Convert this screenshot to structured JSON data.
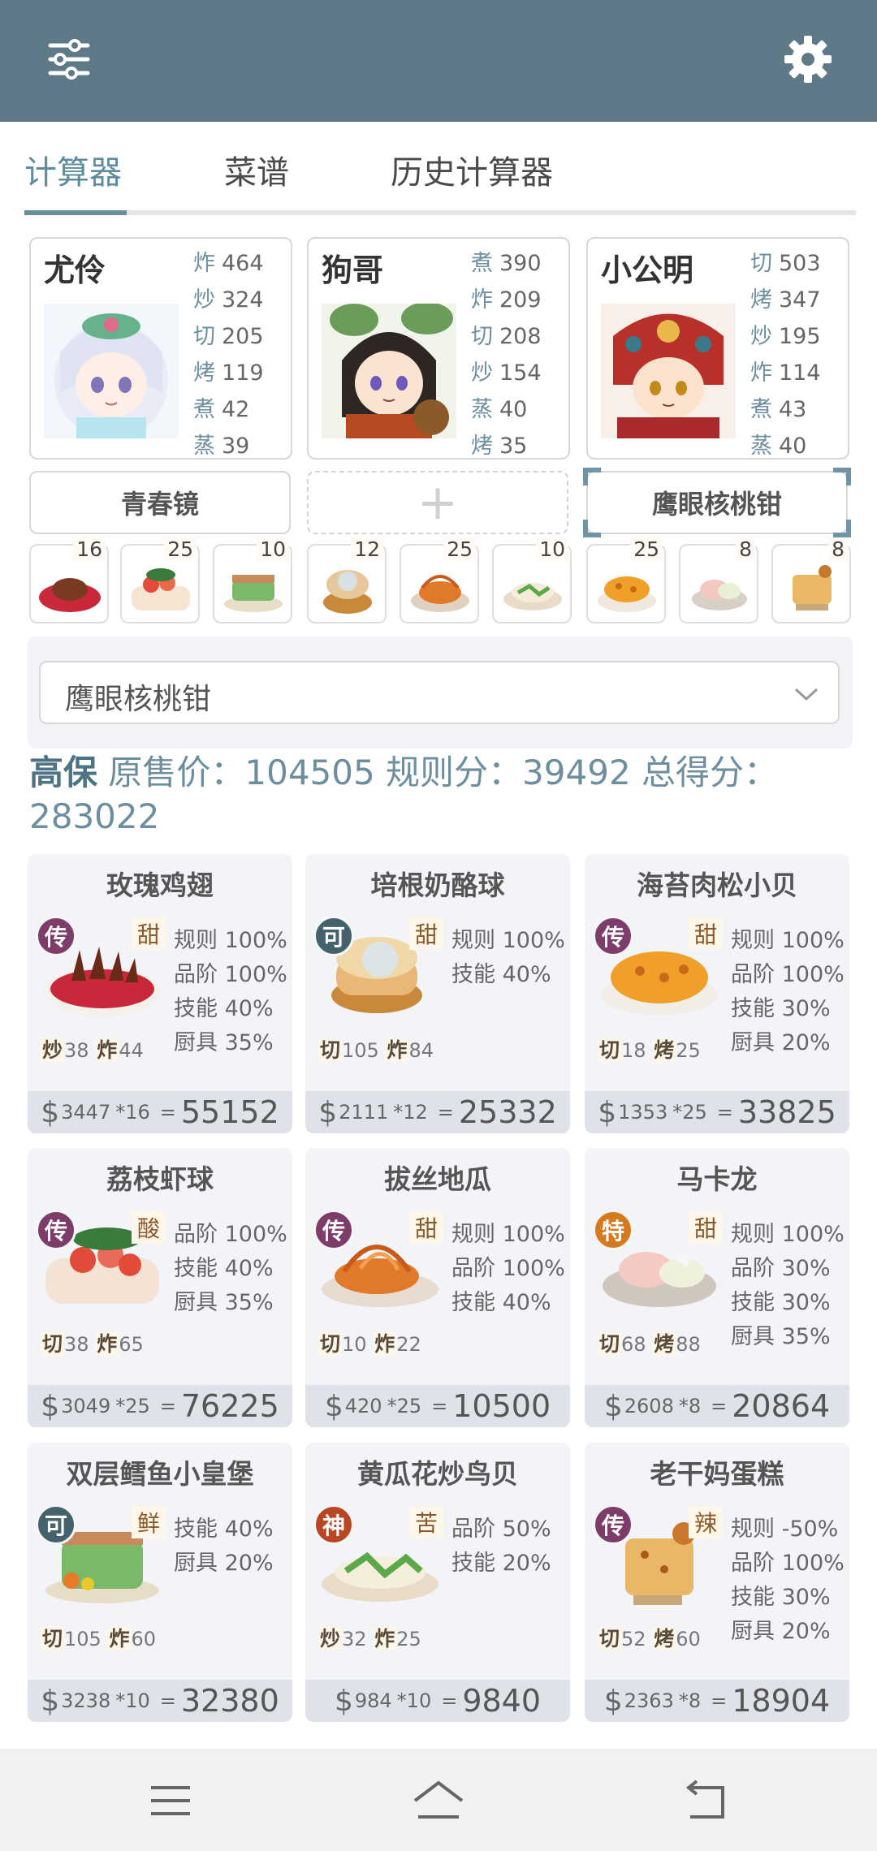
{
  "tabs": [
    {
      "label": "计算器",
      "active": true
    },
    {
      "label": "菜谱",
      "active": false
    },
    {
      "label": "历史计算器",
      "active": false
    }
  ],
  "chefs": [
    {
      "name": "尤伶",
      "stats": [
        [
          "炸",
          "464"
        ],
        [
          "炒",
          "324"
        ],
        [
          "切",
          "205"
        ],
        [
          "烤",
          "119"
        ],
        [
          "煮",
          "42"
        ],
        [
          "蒸",
          "39"
        ]
      ]
    },
    {
      "name": "狗哥",
      "stats": [
        [
          "煮",
          "390"
        ],
        [
          "炸",
          "209"
        ],
        [
          "切",
          "208"
        ],
        [
          "炒",
          "154"
        ],
        [
          "蒸",
          "40"
        ],
        [
          "烤",
          "35"
        ]
      ]
    },
    {
      "name": "小公明",
      "stats": [
        [
          "切",
          "503"
        ],
        [
          "烤",
          "347"
        ],
        [
          "炒",
          "195"
        ],
        [
          "炸",
          "114"
        ],
        [
          "煮",
          "43"
        ],
        [
          "蒸",
          "40"
        ]
      ]
    }
  ],
  "equipment": {
    "slot1": "青春镜",
    "slot2": "+",
    "slot3": "鹰眼核桃钳"
  },
  "thumb_counts": [
    "16",
    "25",
    "10",
    "12",
    "25",
    "10",
    "25",
    "8",
    "8"
  ],
  "dropdown": {
    "value": "鹰眼核桃钳"
  },
  "summary": {
    "grade": "高保",
    "text": "原售价：104505 规则分：39492 总得分：283022"
  },
  "recipes": [
    {
      "title": "玫瑰鸡翅",
      "rank": "传",
      "flavor": "甜",
      "bonus": [
        "规则 100%",
        "品阶 100%",
        "技能 40%",
        "厨具 35%"
      ],
      "skills": [
        [
          "炒",
          "38"
        ],
        [
          "炸",
          "44"
        ]
      ],
      "price": "3447",
      "mult": "*16",
      "total": "55152"
    },
    {
      "title": "培根奶酪球",
      "rank": "可",
      "flavor": "甜",
      "bonus": [
        "规则 100%",
        "技能 40%"
      ],
      "skills": [
        [
          "切",
          "105"
        ],
        [
          "炸",
          "84"
        ]
      ],
      "price": "2111",
      "mult": "*12",
      "total": "25332"
    },
    {
      "title": "海苔肉松小贝",
      "rank": "传",
      "flavor": "甜",
      "bonus": [
        "规则 100%",
        "品阶 100%",
        "技能 30%",
        "厨具 20%"
      ],
      "skills": [
        [
          "切",
          "18"
        ],
        [
          "烤",
          "25"
        ]
      ],
      "price": "1353",
      "mult": "*25",
      "total": "33825"
    },
    {
      "title": "荔枝虾球",
      "rank": "传",
      "flavor": "酸",
      "bonus": [
        "品阶 100%",
        "技能 40%",
        "厨具 35%"
      ],
      "skills": [
        [
          "切",
          "38"
        ],
        [
          "炸",
          "65"
        ]
      ],
      "price": "3049",
      "mult": "*25",
      "total": "76225"
    },
    {
      "title": "拔丝地瓜",
      "rank": "传",
      "flavor": "甜",
      "bonus": [
        "规则 100%",
        "品阶 100%",
        "技能 40%"
      ],
      "skills": [
        [
          "切",
          "10"
        ],
        [
          "炸",
          "22"
        ]
      ],
      "price": "420",
      "mult": "*25",
      "total": "10500"
    },
    {
      "title": "马卡龙",
      "rank": "特",
      "flavor": "甜",
      "bonus": [
        "规则 100%",
        "品阶 30%",
        "技能 30%",
        "厨具 35%"
      ],
      "skills": [
        [
          "切",
          "68"
        ],
        [
          "烤",
          "88"
        ]
      ],
      "price": "2608",
      "mult": "*8",
      "total": "20864"
    },
    {
      "title": "双层鳕鱼小皇堡",
      "rank": "可",
      "flavor": "鲜",
      "bonus": [
        "技能 40%",
        "厨具 20%"
      ],
      "skills": [
        [
          "切",
          "105"
        ],
        [
          "炸",
          "60"
        ]
      ],
      "price": "3238",
      "mult": "*10",
      "total": "32380"
    },
    {
      "title": "黄瓜花炒鸟贝",
      "rank": "神",
      "flavor": "苦",
      "bonus": [
        "品阶 50%",
        "技能 20%"
      ],
      "skills": [
        [
          "炒",
          "32"
        ],
        [
          "炸",
          "25"
        ]
      ],
      "price": "984",
      "mult": "*10",
      "total": "9840"
    },
    {
      "title": "老干妈蛋糕",
      "rank": "传",
      "flavor": "辣",
      "bonus": [
        "规则 -50%",
        "品阶 100%",
        "技能 30%",
        "厨具 20%"
      ],
      "skills": [
        [
          "切",
          "52"
        ],
        [
          "烤",
          "60"
        ]
      ],
      "price": "2363",
      "mult": "*8",
      "total": "18904"
    }
  ]
}
